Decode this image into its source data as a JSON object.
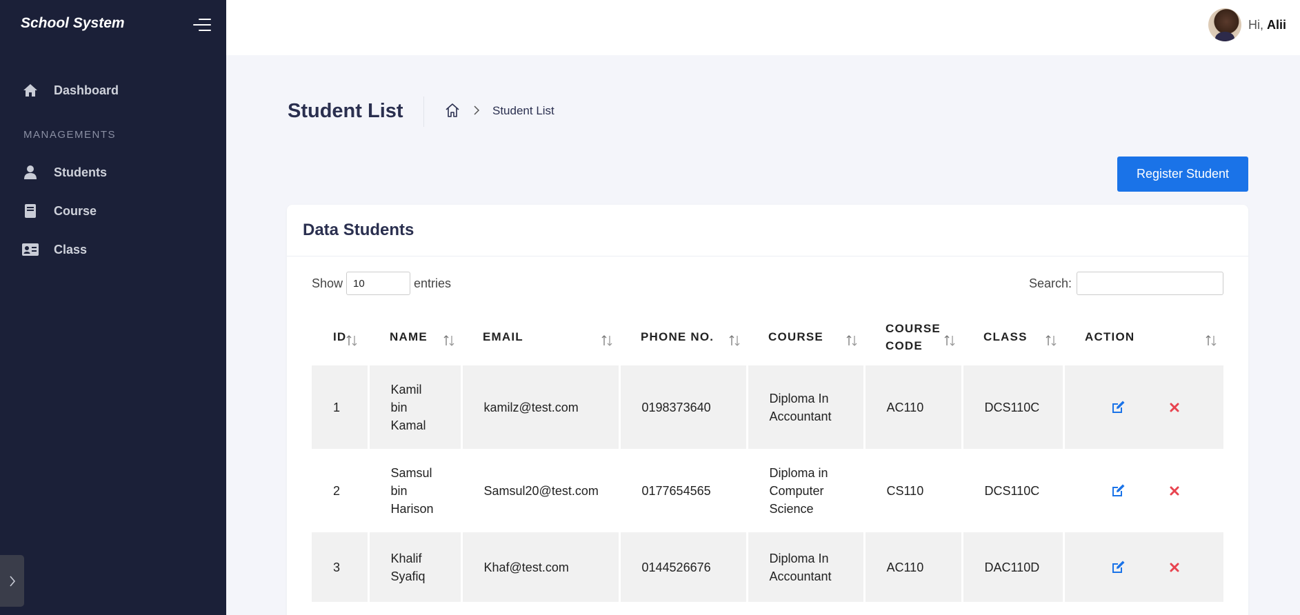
{
  "app": {
    "brand": "School System"
  },
  "sidebar": {
    "items": [
      {
        "label": "Dashboard",
        "icon": "home-icon"
      },
      {
        "label": "Students",
        "icon": "user-icon"
      },
      {
        "label": "Course",
        "icon": "book-icon"
      },
      {
        "label": "Class",
        "icon": "id-card-icon"
      }
    ],
    "section_title": "MANAGEMENTS"
  },
  "header": {
    "greeting": "Hi,",
    "username": "Alii"
  },
  "page": {
    "title": "Student List",
    "breadcrumb_current": "Student List",
    "register_button": "Register Student"
  },
  "card": {
    "title": "Data Students",
    "show_label": "Show",
    "entries_value": "10",
    "entries_label": "entries",
    "search_label": "Search:",
    "search_value": ""
  },
  "table": {
    "headers": [
      "ID",
      "NAME",
      "EMAIL",
      "PHONE NO.",
      "COURSE",
      "COURSE CODE",
      "CLASS",
      "ACTION"
    ],
    "rows": [
      {
        "id": "1",
        "name": "Kamil bin Kamal",
        "email": "kamilz@test.com",
        "phone": "0198373640",
        "course": "Diploma In Accountant",
        "code": "AC110",
        "class": "DCS110C"
      },
      {
        "id": "2",
        "name": "Samsul bin Harison",
        "email": "Samsul20@test.com",
        "phone": "0177654565",
        "course": "Diploma in Computer Science",
        "code": "CS110",
        "class": "DCS110C"
      },
      {
        "id": "3",
        "name": "Khalif Syafiq",
        "email": "Khaf@test.com",
        "phone": "0144526676",
        "course": "Diploma In Accountant",
        "code": "AC110",
        "class": "DAC110D"
      }
    ]
  },
  "colors": {
    "sidebar_bg": "#1b2038",
    "accent": "#1a73e8",
    "delete": "#e8434f",
    "page_bg": "#f4f5fa"
  }
}
